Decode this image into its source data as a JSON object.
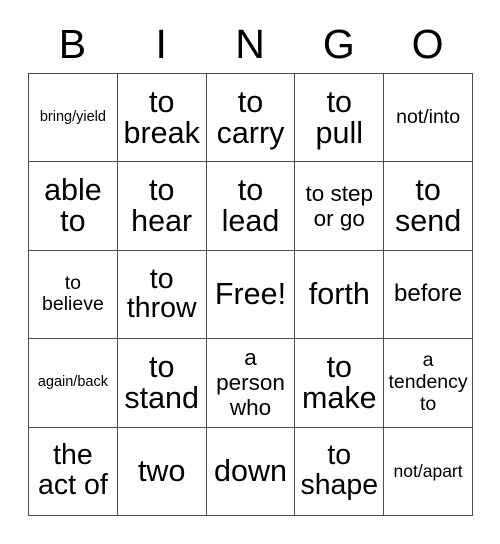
{
  "card": {
    "title_letters": [
      "B",
      "I",
      "N",
      "G",
      "O"
    ],
    "free_space_label": "Free!",
    "rows": [
      [
        {
          "text": "bring/yield",
          "size": "xs"
        },
        {
          "text": "to\nbreak",
          "size": "xl"
        },
        {
          "text": "to\ncarry",
          "size": "xl"
        },
        {
          "text": "to\npull",
          "size": "xl"
        },
        {
          "text": "not/into",
          "size": "sm"
        }
      ],
      [
        {
          "text": "able\nto",
          "size": "xl"
        },
        {
          "text": "to\nhear",
          "size": "xl"
        },
        {
          "text": "to\nlead",
          "size": "xl"
        },
        {
          "text": "to step\nor go",
          "size": "m"
        },
        {
          "text": "to\nsend",
          "size": "xl"
        }
      ],
      [
        {
          "text": "to\nbelieve",
          "size": "sm"
        },
        {
          "text": "to\nthrow",
          "size": "l"
        },
        {
          "text": "Free!",
          "size": "xl"
        },
        {
          "text": "forth",
          "size": "xl"
        },
        {
          "text": "before",
          "size": "ml"
        }
      ],
      [
        {
          "text": "again/back",
          "size": "xs"
        },
        {
          "text": "to\nstand",
          "size": "xl"
        },
        {
          "text": "a\nperson\nwho",
          "size": "m"
        },
        {
          "text": "to\nmake",
          "size": "xl"
        },
        {
          "text": "a\ntendency\nto",
          "size": "sm"
        }
      ],
      [
        {
          "text": "the\nact of",
          "size": "l"
        },
        {
          "text": "two",
          "size": "xl"
        },
        {
          "text": "down",
          "size": "xl"
        },
        {
          "text": "to\nshape",
          "size": "l"
        },
        {
          "text": "not/apart",
          "size": "s"
        }
      ]
    ],
    "colors": {
      "border": "#4d4d4d",
      "text": "#000000",
      "background": "#ffffff"
    }
  }
}
